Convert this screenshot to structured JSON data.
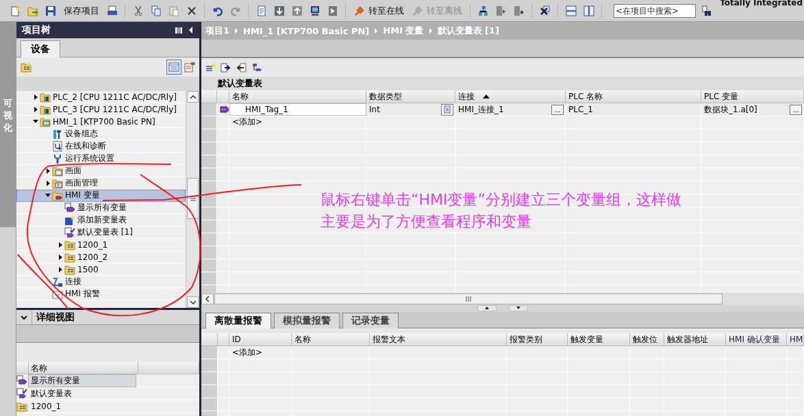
{
  "toolbar": {
    "buttons": [
      {
        "label": "保存项目",
        "disabled": false
      },
      {
        "label": "转至在线",
        "disabled": false
      },
      {
        "label": "转至离线",
        "disabled": true
      }
    ],
    "search": {
      "placeholder": "<在项目中搜索>"
    },
    "brand": "Totally Integrated"
  },
  "side_strip": {
    "label": "可视化"
  },
  "project_tree": {
    "title": "项目树",
    "tabs": [
      {
        "label": "设备",
        "selected": true
      }
    ],
    "items": [
      {
        "label": "PLC_2 [CPU 1211C AC/DC/Rly]",
        "kind": "plc",
        "expanded": false,
        "selected": false
      },
      {
        "label": "PLC_3 [CPU 1211C AC/DC/Rly]",
        "kind": "plc",
        "expanded": false,
        "selected": false
      },
      {
        "label": "HMI_1 [KTP700 Basic PN]",
        "kind": "hmi",
        "expanded": true,
        "selected": false,
        "children": [
          {
            "label": "设备组态",
            "kind": "config",
            "selected": false
          },
          {
            "label": "在线和诊断",
            "kind": "diagnostics",
            "selected": false
          },
          {
            "label": "运行系统设置",
            "kind": "runtime",
            "selected": false
          },
          {
            "label": "画面",
            "kind": "screens",
            "expanded": false,
            "selected": false
          },
          {
            "label": "画面管理",
            "kind": "screen-mgmt",
            "expanded": false,
            "selected": false
          },
          {
            "label": "HMI 变量",
            "kind": "tags",
            "expanded": true,
            "selected": true,
            "children": [
              {
                "label": "显示所有变量",
                "kind": "show-all",
                "selected": false
              },
              {
                "label": "添加新变量表",
                "kind": "add-table",
                "selected": false
              },
              {
                "label": "默认变量表 [1]",
                "kind": "tag-table",
                "selected": false
              },
              {
                "label": "1200_1",
                "kind": "tag-group",
                "expanded": false,
                "selected": false
              },
              {
                "label": "1200_2",
                "kind": "tag-group",
                "expanded": false,
                "selected": false
              },
              {
                "label": "1500",
                "kind": "tag-group",
                "expanded": false,
                "selected": false
              }
            ]
          },
          {
            "label": "连接",
            "kind": "connection",
            "selected": false
          },
          {
            "label": "HMI 报警",
            "kind": "alarms",
            "selected": false
          }
        ]
      }
    ]
  },
  "detail_view": {
    "title": "详细视图",
    "columns": [
      "名称"
    ],
    "rows": [
      {
        "label": "显示所有变量",
        "kind": "show-all",
        "selected": true
      },
      {
        "label": "默认变量表",
        "kind": "tag-table",
        "selected": false
      },
      {
        "label": "1200_1",
        "kind": "tag-group",
        "selected": false
      }
    ]
  },
  "breadcrumb": [
    "项目1",
    "HMI_1 [KTP700 Basic PN]",
    "HMI 变量",
    "默认变量表 [1]"
  ],
  "editor": {
    "title": "默认变量表",
    "tag_table": {
      "columns": [
        {
          "label": "名称"
        },
        {
          "label": "数据类型"
        },
        {
          "label": "连接",
          "sorted": true
        },
        {
          "label": "PLC 名称"
        },
        {
          "label": "PLC 变量"
        }
      ],
      "rows": [
        {
          "name": "HMI_Tag_1",
          "data_type": "Int",
          "connection": "HMI_连接_1",
          "connection_button": "...",
          "plc_name": "PLC_1",
          "plc_tag": "数据块_1.a[0]",
          "plc_tag_button": "..."
        }
      ],
      "add_row": "<添加>"
    }
  },
  "alarm_panel": {
    "tabs": [
      {
        "label": "离散量报警",
        "selected": true
      },
      {
        "label": "模拟量报警",
        "selected": false
      },
      {
        "label": "记录变量",
        "selected": false
      }
    ],
    "columns": [
      "ID",
      "名称",
      "报警文本",
      "报警类别",
      "触发变量",
      "触发位",
      "触发器地址",
      "HMI 确认变量",
      "HM"
    ],
    "add_row": "<添加>"
  },
  "annotation": {
    "lines": [
      "鼠标右键单击“HMI变量”分别建立三个变量组，这样做",
      "主要是为了方便查看程序和变量"
    ]
  }
}
